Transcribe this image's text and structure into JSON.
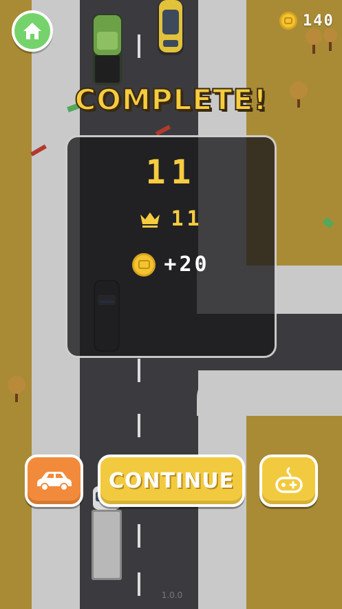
{
  "hud": {
    "home_icon": "home-icon",
    "coin_icon": "coin-icon",
    "coin_total": "140"
  },
  "result": {
    "title": "COMPLETE!",
    "score": "11",
    "best_icon": "crown-icon",
    "best_score": "11",
    "reward_icon": "coin-icon",
    "reward": "+20"
  },
  "buttons": {
    "garage_icon": "car-icon",
    "continue_label": "CONTINUE",
    "game_icon": "gamepad-icon"
  },
  "footer": {
    "version": "1.0.0"
  },
  "colors": {
    "ground": "#a98b36",
    "road": "#3b3b3f",
    "accent_yellow": "#f2ca3f",
    "home_green": "#76d36c",
    "garage_orange": "#f28a3b"
  }
}
